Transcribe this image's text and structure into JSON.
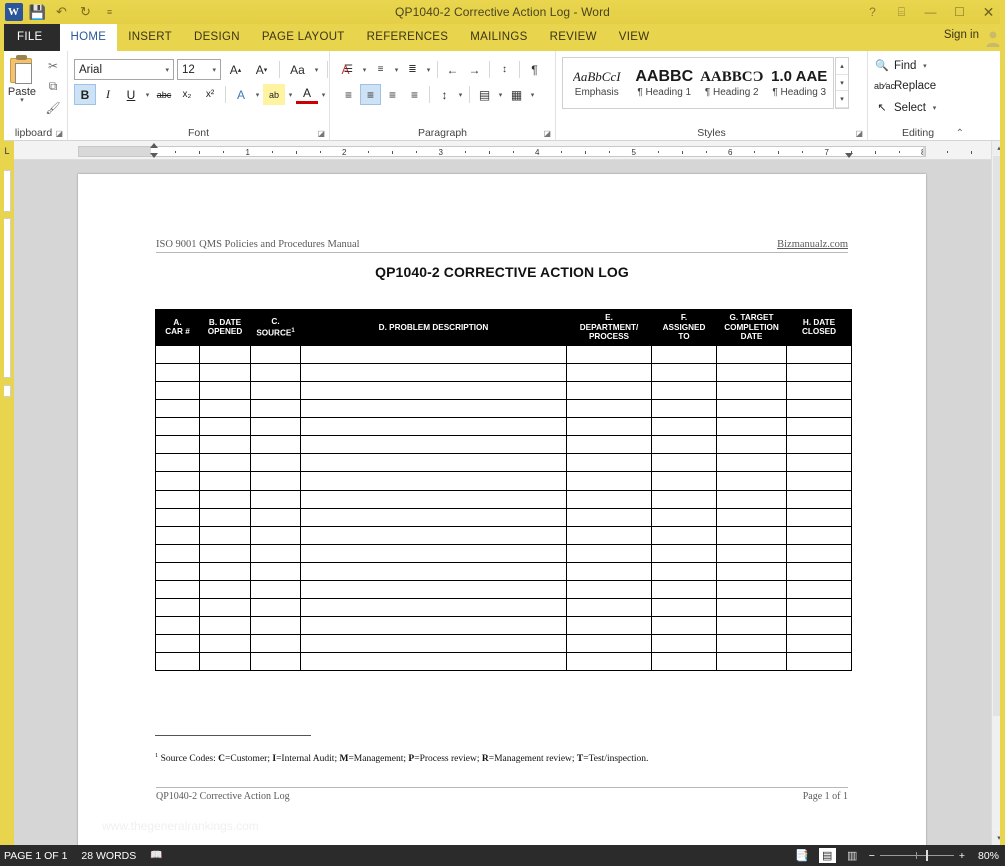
{
  "window": {
    "title": "QP1040-2 Corrective Action Log - Word",
    "app_icon": "word-icon",
    "quick_access": [
      {
        "name": "save-icon",
        "glyph": "💾"
      },
      {
        "name": "undo-icon",
        "glyph": "↶"
      },
      {
        "name": "redo-icon",
        "glyph": "↻"
      },
      {
        "name": "customize-qat-icon",
        "glyph": "≡"
      }
    ],
    "controls": {
      "help": "?",
      "ribbon_display": "⌸",
      "minimize": "—",
      "maximize": "☐",
      "close": "✕"
    }
  },
  "tabs": [
    {
      "label": "FILE"
    },
    {
      "label": "HOME"
    },
    {
      "label": "INSERT"
    },
    {
      "label": "DESIGN"
    },
    {
      "label": "PAGE LAYOUT"
    },
    {
      "label": "REFERENCES"
    },
    {
      "label": "MAILINGS"
    },
    {
      "label": "REVIEW"
    },
    {
      "label": "VIEW"
    }
  ],
  "account": {
    "sign_in": "Sign in"
  },
  "ribbon": {
    "clipboard": {
      "group_label": "lipboard",
      "paste_label": "Paste",
      "cut_icon": "✂",
      "copy_icon": "⧉",
      "format_painter_icon": "🖌"
    },
    "font": {
      "group_label": "Font",
      "font_name": "Arial",
      "font_size": "12",
      "grow_font": "A",
      "shrink_font": "A",
      "change_case": "Aa",
      "clear_formatting": "A",
      "bold": "B",
      "italic": "I",
      "underline": "U",
      "strikethrough": "abc",
      "subscript": "x₂",
      "superscript": "x²",
      "text_effects": "A",
      "highlight": "ab",
      "font_color": "A"
    },
    "paragraph": {
      "group_label": "Paragraph",
      "bullets": "☰",
      "numbering": "≡",
      "multilevel": "≣",
      "decrease_indent": "←",
      "increase_indent": "→",
      "sort": "↕",
      "show_marks": "¶",
      "align_left": "≡",
      "align_center": "≡",
      "align_right": "≡",
      "justify": "≡",
      "line_spacing": "↕",
      "shading": "▤",
      "borders": "▦"
    },
    "styles": {
      "group_label": "Styles",
      "items": [
        {
          "preview": "AaBbCcI",
          "name": "Emphasis"
        },
        {
          "preview": "AABBC",
          "name": "¶ Heading 1"
        },
        {
          "preview": "AABBCƆ",
          "name": "¶ Heading 2"
        },
        {
          "preview": "1.0 AAE",
          "name": "¶ Heading 3"
        }
      ]
    },
    "editing": {
      "group_label": "Editing",
      "find": "Find",
      "replace": "Replace",
      "select": "Select"
    }
  },
  "ruler": {
    "h_ticks": [
      "1",
      "2",
      "3",
      "4",
      "5",
      "6",
      "7",
      "8"
    ],
    "left_tab_marker": "L"
  },
  "document": {
    "header_left": "ISO 9001 QMS Policies and Procedures Manual",
    "header_right": "Bizmanualz.com",
    "title": "QP1040-2 CORRECTIVE ACTION LOG",
    "table": {
      "columns": [
        {
          "label": "A.\nCAR #",
          "lines": [
            "A.",
            "CAR #"
          ],
          "width": "44"
        },
        {
          "label": "B. DATE OPENED",
          "lines": [
            "B. DATE",
            "OPENED"
          ],
          "width": "51"
        },
        {
          "label": "C. SOURCE",
          "lines": [
            "C.",
            "SOURCE¹"
          ],
          "width": "50"
        },
        {
          "label": "D. PROBLEM DESCRIPTION",
          "lines": [
            "D. PROBLEM DESCRIPTION"
          ],
          "width": "266"
        },
        {
          "label": "E. DEPARTMENT/ PROCESS",
          "lines": [
            "E.",
            "DEPARTMENT/",
            "PROCESS"
          ],
          "width": "85"
        },
        {
          "label": "F. ASSIGNED TO",
          "lines": [
            "F.",
            "ASSIGNED",
            "TO"
          ],
          "width": "65"
        },
        {
          "label": "G. TARGET COMPLETION DATE",
          "lines": [
            "G. TARGET",
            "COMPLETION",
            "DATE"
          ],
          "width": "70"
        },
        {
          "label": "H. DATE CLOSED",
          "lines": [
            "H. DATE",
            "CLOSED"
          ],
          "width": "65"
        }
      ],
      "empty_row_count": 18
    },
    "footnote_marker": "1",
    "footnote": "Source Codes: C=Customer; I=Internal Audit; M=Management; P=Process review; R=Management review; T=Test/inspection.",
    "footer_left": "QP1040-2 Corrective Action Log",
    "footer_right": "Page 1 of 1",
    "watermark": "www.thegeneralrankings.com"
  },
  "status_bar": {
    "page": "PAGE 1 OF 1",
    "words": "28 WORDS",
    "proofing_icon": "📖",
    "views": [
      {
        "name": "read-mode",
        "glyph": "📑",
        "active": false
      },
      {
        "name": "print-layout",
        "glyph": "▤",
        "active": true
      },
      {
        "name": "web-layout",
        "glyph": "▥",
        "active": false
      }
    ],
    "zoom_out": "−",
    "zoom_in": "+",
    "zoom_level": "80%"
  }
}
